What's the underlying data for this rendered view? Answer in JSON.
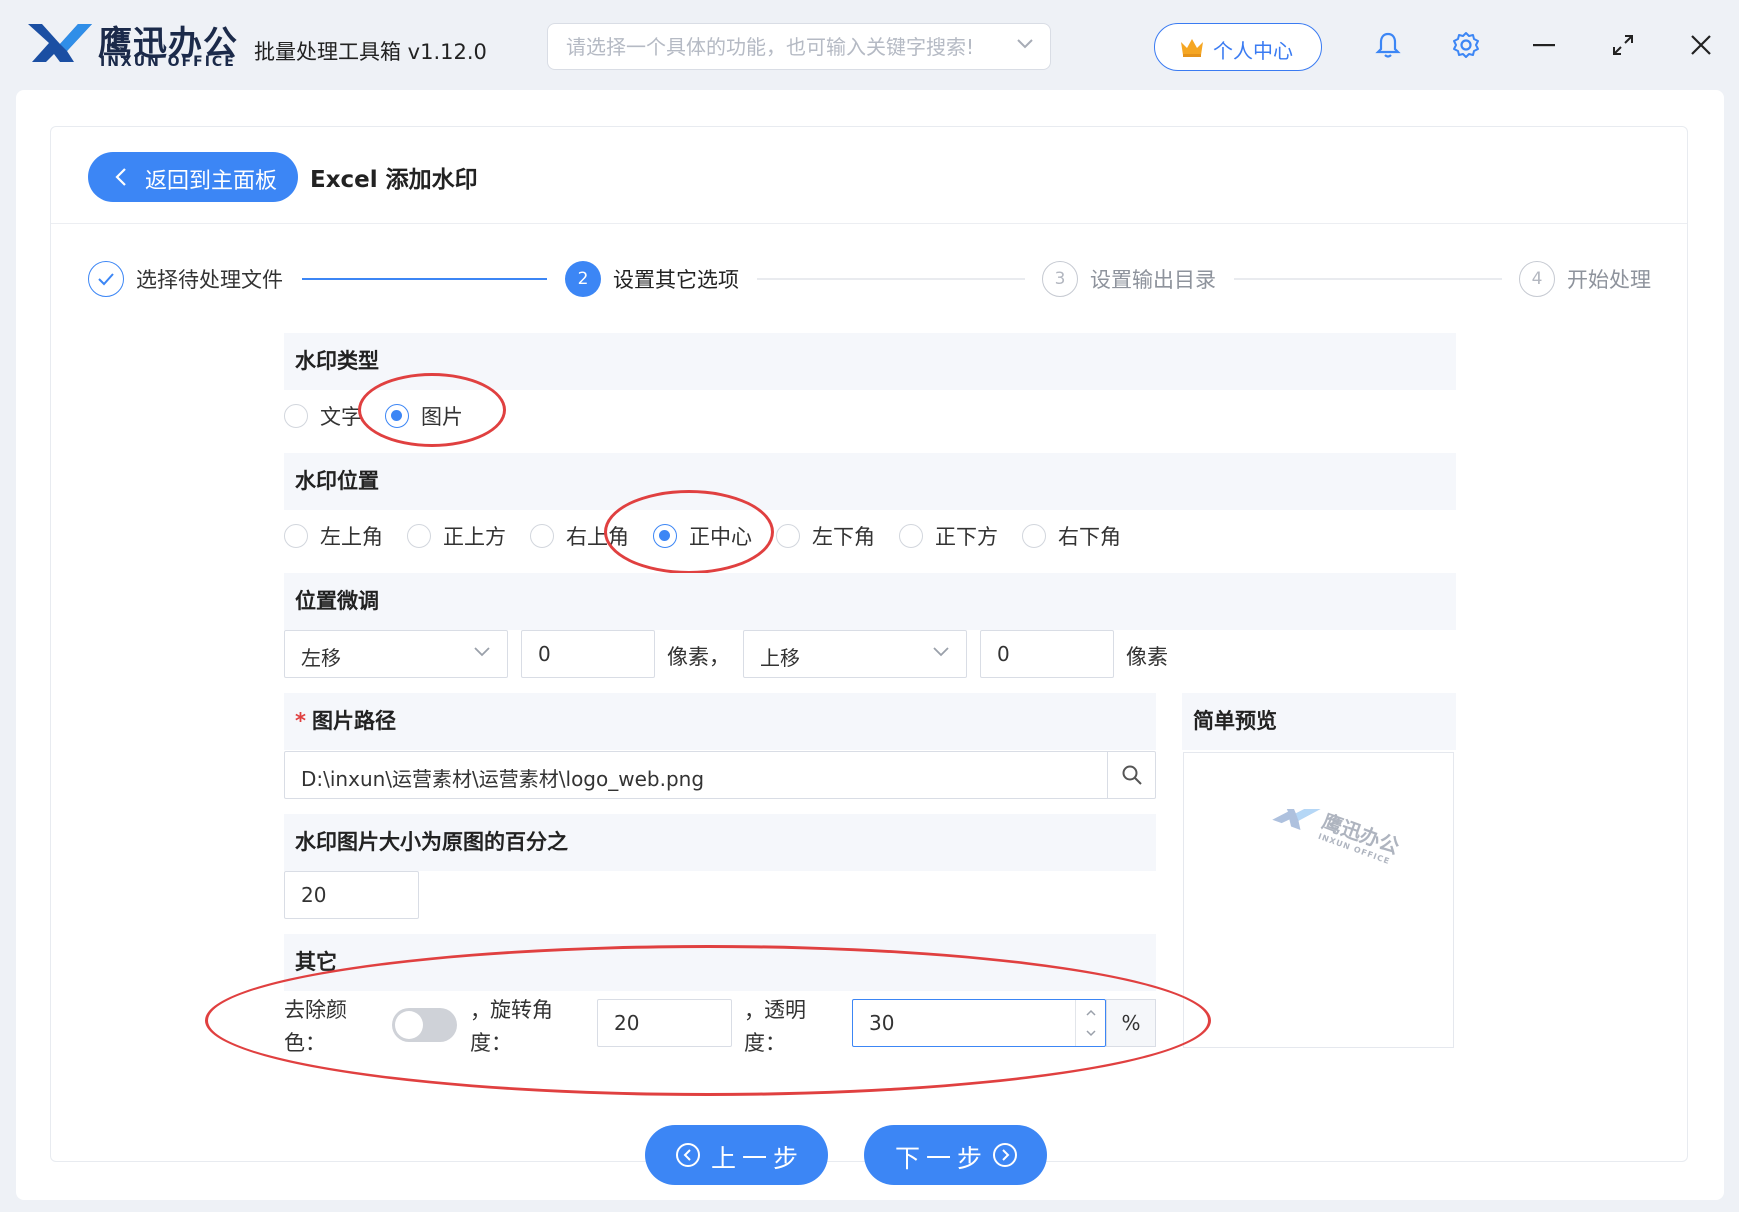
{
  "app": {
    "brand_cn": "鹰迅办公",
    "brand_en": "INXUN OFFICE",
    "title": "批量处理工具箱 v1.12.0",
    "search_placeholder": "请选择一个具体的功能，也可输入关键字搜索!",
    "user_center_label": "个人中心",
    "accent_color": "#3c86f5",
    "icons": [
      "bell-icon",
      "gear-icon",
      "minimize-icon",
      "maximize-icon",
      "close-icon"
    ]
  },
  "header": {
    "back_label": "返回到主面板",
    "page_title": "Excel 添加水印"
  },
  "steps": [
    {
      "number": "✓",
      "label": "选择待处理文件",
      "state": "done"
    },
    {
      "number": "2",
      "label": "设置其它选项",
      "state": "active"
    },
    {
      "number": "3",
      "label": "设置输出目录",
      "state": "todo"
    },
    {
      "number": "4",
      "label": "开始处理",
      "state": "todo"
    }
  ],
  "watermark_type": {
    "heading": "水印类型",
    "options": [
      "文字",
      "图片"
    ],
    "selected": "图片"
  },
  "watermark_position": {
    "heading": "水印位置",
    "options": [
      "左上角",
      "正上方",
      "右上角",
      "正中心",
      "左下角",
      "正下方",
      "右下角"
    ],
    "selected": "正中心"
  },
  "fine_tune": {
    "heading": "位置微调",
    "horizontal_dir": "左移",
    "horizontal_value": "0",
    "unit1": "像素，",
    "vertical_dir": "上移",
    "vertical_value": "0",
    "unit2": "像素"
  },
  "image_path": {
    "required_mark": "*",
    "heading": "图片路径",
    "value": "D:\\inxun\\运营素材\\运营素材\\logo_web.png"
  },
  "scale": {
    "heading": "水印图片大小为原图的百分之",
    "value": "20"
  },
  "preview": {
    "heading": "简单预览",
    "logo_cn": "鹰迅办公",
    "logo_en": "INXUN OFFICE"
  },
  "other": {
    "heading": "其它",
    "remove_color_label_1": "去除颜",
    "remove_color_label_2": "色：",
    "remove_color_on": false,
    "rotate_prefix": "，",
    "rotate_label_1": "旋转角",
    "rotate_label_2": "度：",
    "rotate_value": "20",
    "opacity_prefix": "，",
    "opacity_label_1": "透明",
    "opacity_label_2": "度：",
    "opacity_value": "30",
    "opacity_unit": "%"
  },
  "footer": {
    "prev_label": "上一步",
    "next_label": "下一步"
  }
}
